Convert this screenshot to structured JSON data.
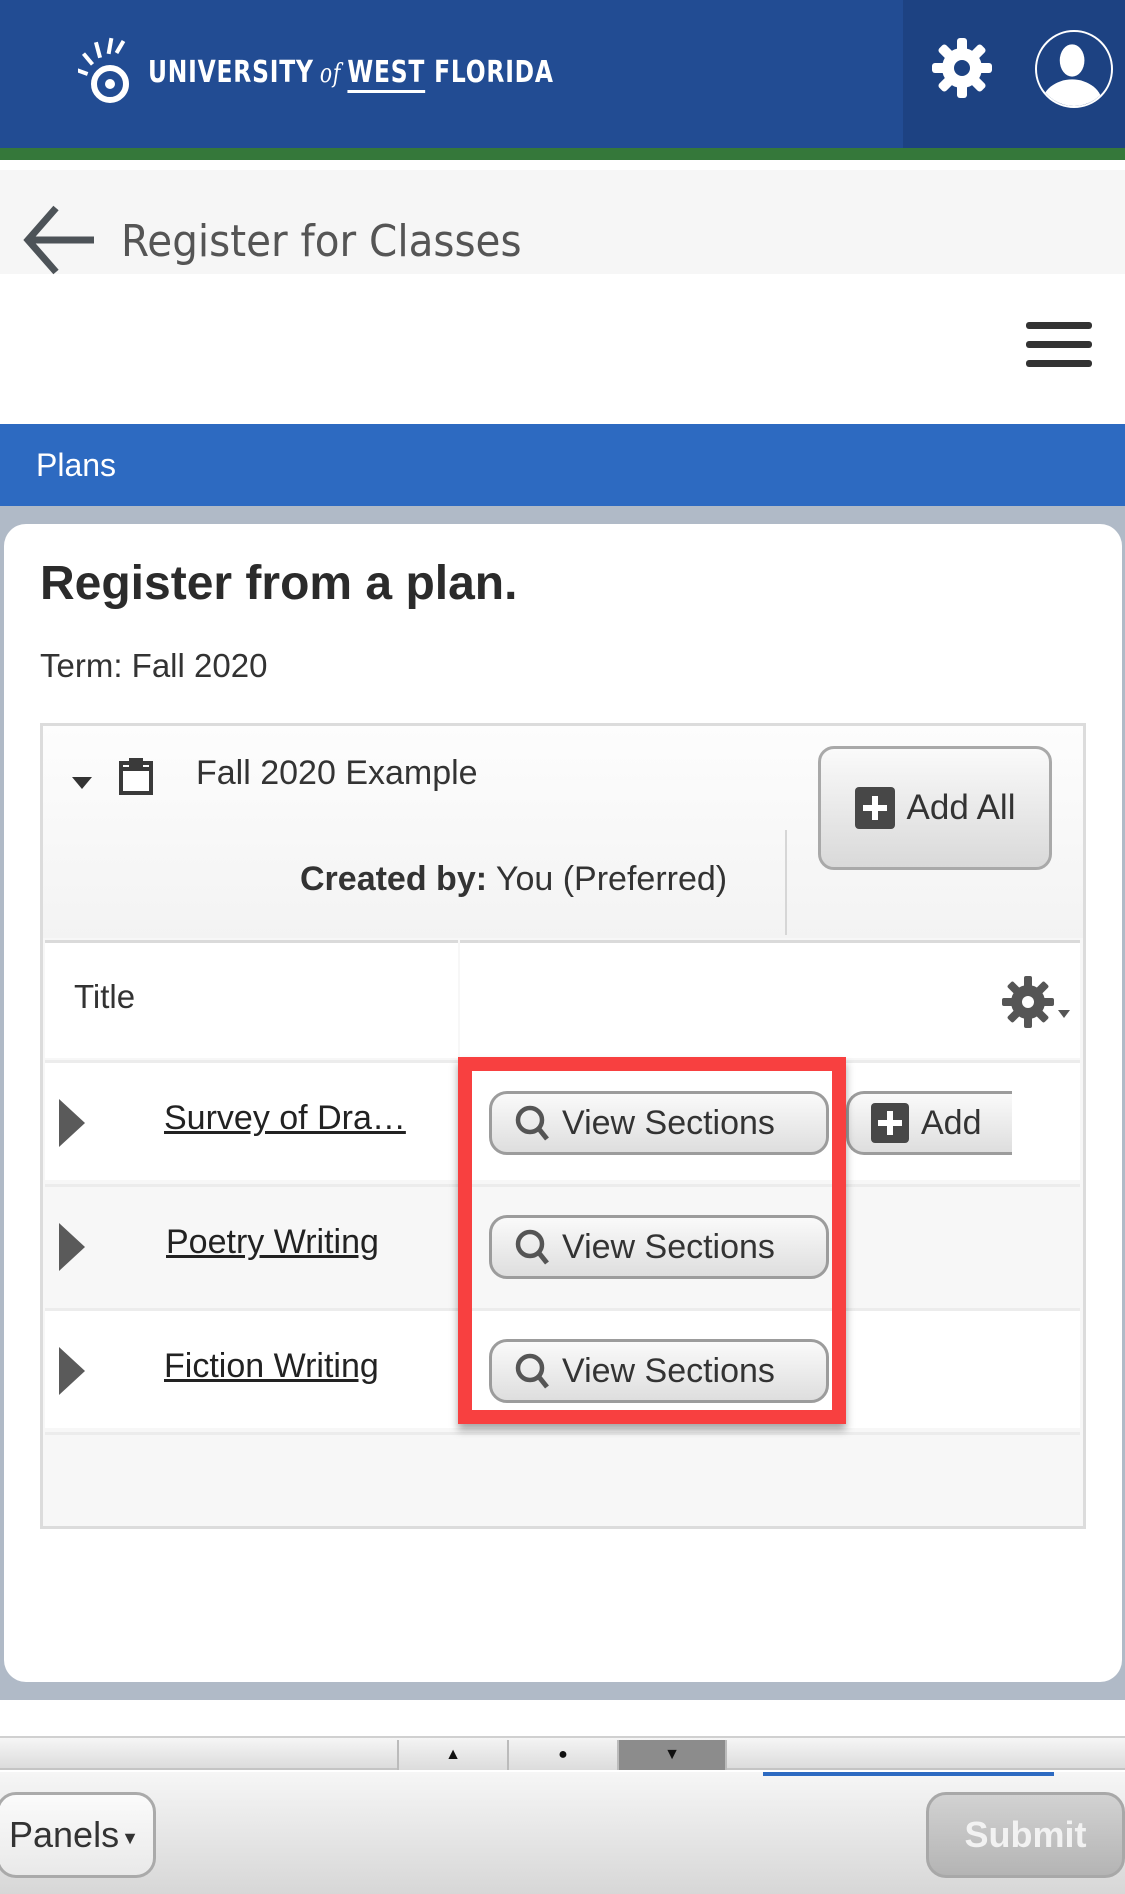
{
  "header": {
    "logo_text_1": "UNIVERSITY",
    "logo_text_of": "of",
    "logo_text_2": "WEST",
    "logo_text_3": "FLORIDA",
    "icons": [
      "logo-icon",
      "gear-icon",
      "user-avatar-icon"
    ]
  },
  "title_bar": {
    "title": "Register for Classes",
    "back_icon": "arrow-left-icon",
    "menu_icon": "hamburger-icon"
  },
  "section": {
    "band_label": "Plans",
    "heading": "Register from a plan.",
    "term": "Term: Fall 2020"
  },
  "plan": {
    "name": "Fall 2020 Example",
    "created_by_label": "Created by:",
    "created_by_value": "You (Preferred)",
    "add_all_label": "Add All"
  },
  "table": {
    "columns": [
      "Title",
      ""
    ],
    "rows": [
      {
        "title": "Survey of Dra…",
        "view_label": "View Sections",
        "add_label": "Add"
      },
      {
        "title": "Poetry Writing",
        "view_label": "View Sections"
      },
      {
        "title": "Fiction Writing",
        "view_label": "View Sections"
      }
    ]
  },
  "colors": {
    "header_blue": "#224c93",
    "accent_green": "#35783a",
    "band_blue": "#2d6ac1",
    "highlight_red": "#f84040"
  },
  "bottom": {
    "panels_label": "Panels",
    "submit_label": "Submit",
    "scroll_up": "▲",
    "scroll_mid": "●",
    "scroll_down": "▼"
  }
}
